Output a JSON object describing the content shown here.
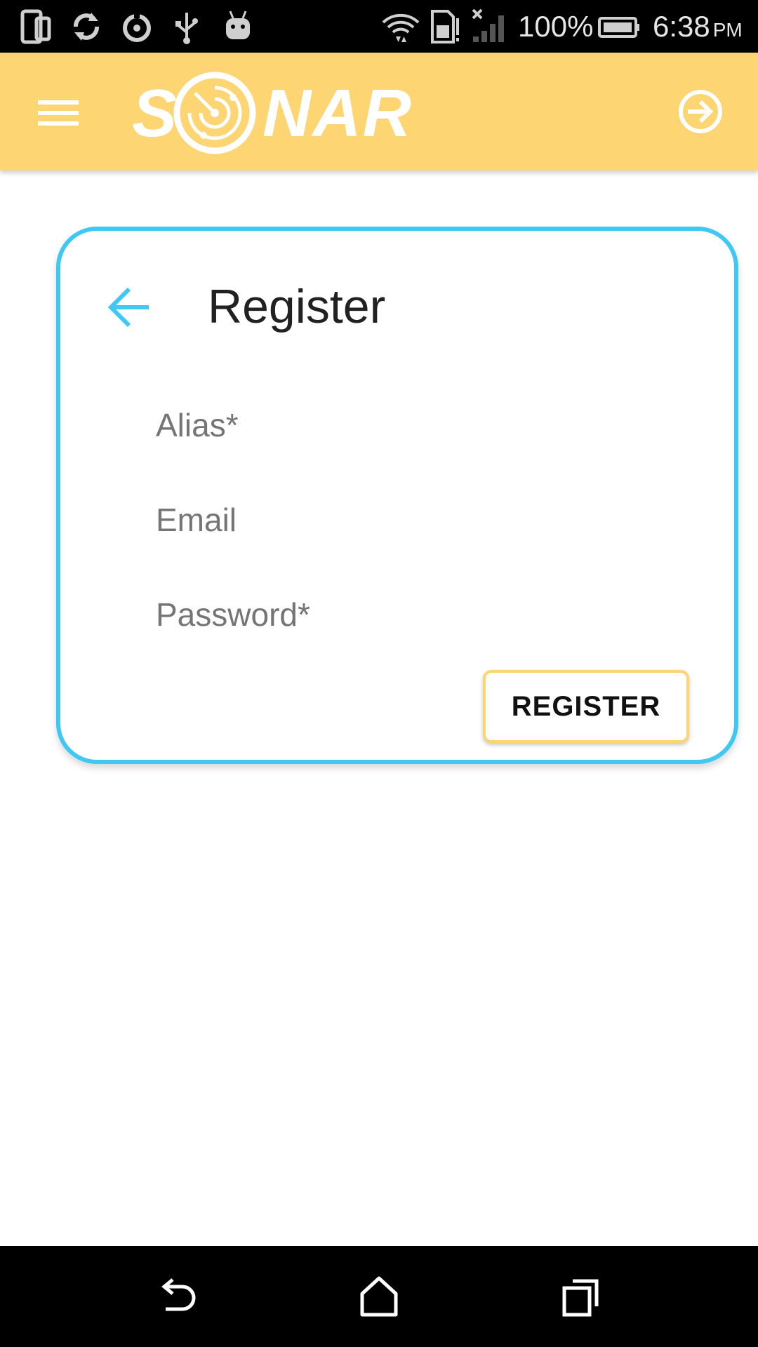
{
  "status_bar": {
    "battery_percent": "100%",
    "time": "6:38",
    "ampm": "PM",
    "icons": [
      "tablet-icon",
      "sync-icon",
      "circle-target-icon",
      "usb-icon",
      "android-icon",
      "wifi-icon",
      "sim-alert-icon",
      "signal-icon",
      "battery-icon"
    ]
  },
  "app_bar": {
    "logo_text_left": "S",
    "logo_text_right": "NAR",
    "menu_icon": "hamburger-menu-icon",
    "login_icon": "login-arrow-icon",
    "background_color": "#fdd573"
  },
  "card": {
    "title": "Register",
    "back_icon": "arrow-left-icon",
    "border_color": "#3ec8f3",
    "fields": {
      "alias": {
        "placeholder": "Alias*",
        "value": ""
      },
      "email": {
        "placeholder": "Email",
        "value": ""
      },
      "password": {
        "placeholder": "Password*",
        "value": ""
      }
    },
    "register_label": "REGISTER"
  },
  "nav_bar": {
    "icons": [
      "back-icon",
      "home-icon",
      "recent-apps-icon"
    ]
  }
}
